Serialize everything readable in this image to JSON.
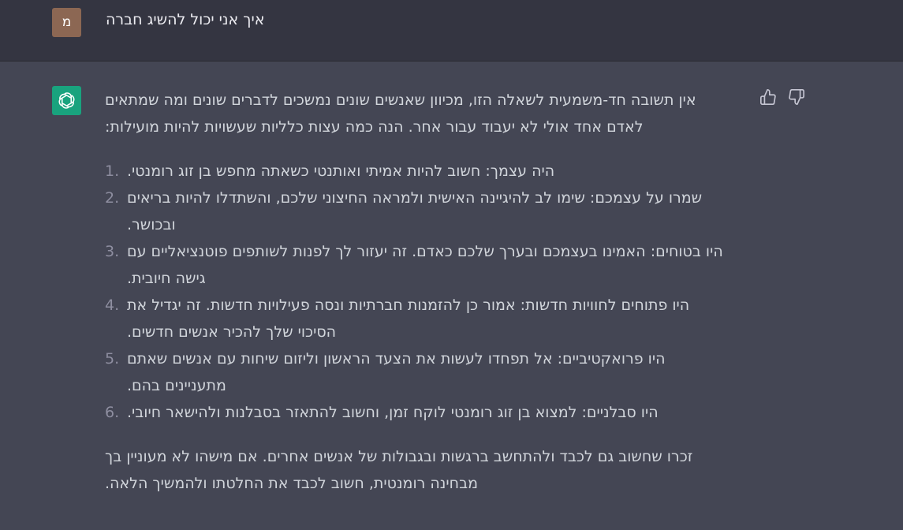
{
  "user": {
    "avatar_letter": "מ",
    "question": "איך אני יכול להשיג חברה"
  },
  "assistant": {
    "intro": "אין תשובה חד-משמעית לשאלה הזו, מכיוון שאנשים שונים נמשכים לדברים שונים ומה שמתאים לאדם אחד אולי לא יעבוד עבור אחר. הנה כמה עצות כלליות שעשויות להיות מועילות:",
    "tips": [
      {
        "num": "1.",
        "text": "היה עצמך: חשוב להיות אמיתי ואותנטי כשאתה מחפש בן זוג רומנטי."
      },
      {
        "num": "2.",
        "text": "שמרו על עצמכם: שימו לב להיגיינה האישית ולמראה החיצוני שלכם, והשתדלו להיות בריאים ובכושר."
      },
      {
        "num": "3.",
        "text": "היו בטוחים: האמינו בעצמכם ובערך שלכם כאדם. זה יעזור לך לפנות לשותפים פוטנציאליים עם גישה חיובית."
      },
      {
        "num": "4.",
        "text": "היו פתוחים לחוויות חדשות: אמור כן להזמנות חברתיות ונסה פעילויות חדשות. זה יגדיל את הסיכוי שלך להכיר אנשים חדשים."
      },
      {
        "num": "5.",
        "text": "היו פרואקטיביים: אל תפחדו לעשות את הצעד הראשון וליזום שיחות עם אנשים שאתם מתעניינים בהם."
      },
      {
        "num": "6.",
        "text": "היו סבלניים: למצוא בן זוג רומנטי לוקח זמן, וחשוב להתאזר בסבלנות ולהישאר חיובי."
      }
    ],
    "closing": "זכרו שחשוב גם לכבד ולהתחשב ברגשות ובגבולות של אנשים אחרים. אם מישהו לא מעוניין בך מבחינה רומנטית, חשוב לכבד את החלטתו ולהמשיך הלאה."
  },
  "icons": {
    "gpt_logo": "openai-logo-icon",
    "thumbs_up": "thumbs-up-icon",
    "thumbs_down": "thumbs-down-icon"
  },
  "colors": {
    "user_bg": "#343541",
    "assistant_bg": "#444654",
    "gpt_avatar": "#19a37e",
    "user_avatar": "#8c6753"
  }
}
